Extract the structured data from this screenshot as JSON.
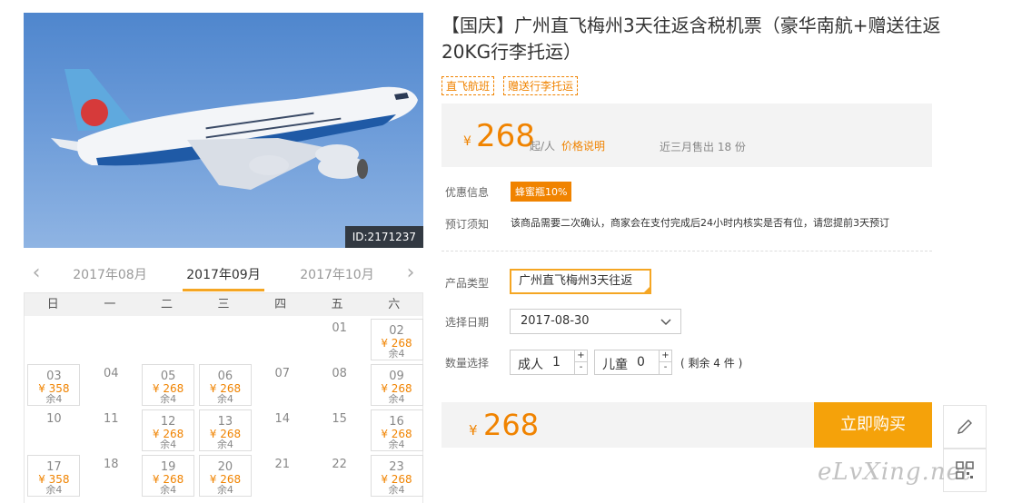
{
  "image": {
    "id_label": "ID:2171237"
  },
  "calendar": {
    "prev_icon": "chevron-left-icon",
    "next_icon": "chevron-right-icon",
    "months": [
      "2017年08月",
      "2017年09月",
      "2017年10月"
    ],
    "active_month_index": 1,
    "weekdays": [
      "日",
      "一",
      "二",
      "三",
      "四",
      "五",
      "六"
    ],
    "cells": [
      {
        "day": "01"
      },
      {
        "day": "02",
        "price": "¥ 268",
        "remain": "余4"
      },
      {
        "day": "03",
        "price": "¥ 358",
        "remain": "余4"
      },
      {
        "day": "04"
      },
      {
        "day": "05",
        "price": "¥ 268",
        "remain": "余4"
      },
      {
        "day": "06",
        "price": "¥ 268",
        "remain": "余4"
      },
      {
        "day": "07"
      },
      {
        "day": "08"
      },
      {
        "day": "09",
        "price": "¥ 268",
        "remain": "余4"
      },
      {
        "day": "10"
      },
      {
        "day": "11"
      },
      {
        "day": "12",
        "price": "¥ 268",
        "remain": "余4"
      },
      {
        "day": "13",
        "price": "¥ 268",
        "remain": "余4"
      },
      {
        "day": "14"
      },
      {
        "day": "15"
      },
      {
        "day": "16",
        "price": "¥ 268",
        "remain": "余4"
      },
      {
        "day": "17",
        "price": "¥ 358",
        "remain": "余4"
      },
      {
        "day": "18"
      },
      {
        "day": "19",
        "price": "¥ 268",
        "remain": "余4"
      },
      {
        "day": "20",
        "price": "¥ 268",
        "remain": "余4"
      },
      {
        "day": "21"
      },
      {
        "day": "22"
      },
      {
        "day": "23",
        "price": "¥ 268",
        "remain": "余4"
      }
    ]
  },
  "product": {
    "title": "【国庆】广州直飞梅州3天往返含税机票（豪华南航+赠送往返20KG行李托运）",
    "tags": [
      "直飞航班",
      "赠送行李托运"
    ],
    "price": {
      "currency": "¥",
      "amount": "268",
      "unit": "起/人",
      "explain_link": "价格说明",
      "sold": "近三月售出 18 份"
    },
    "promo": {
      "label": "优惠信息",
      "badge": "蜂蜜瓶10%"
    },
    "notice": {
      "label": "预订须知",
      "text": "该商品需要二次确认，商家会在支付完成后24小时内核实是否有位，请您提前3天预订"
    },
    "type": {
      "label": "产品类型",
      "value": "广州直飞梅州3天往返"
    },
    "date": {
      "label": "选择日期",
      "value": "2017-08-30",
      "chevron_icon": "chevron-down-icon"
    },
    "qty": {
      "label": "数量选择",
      "adult_label": "成人",
      "adult_value": "1",
      "child_label": "儿童",
      "child_value": "0",
      "up": "+",
      "down": "-",
      "remain": "( 剩余 4 件 )"
    }
  },
  "buy": {
    "currency": "¥",
    "total": "268",
    "button": "立即购买"
  },
  "side": {
    "edit_icon": "pencil-icon",
    "qr_icon": "qr-code-icon"
  },
  "watermark": "eLvXing.net",
  "colors": {
    "accent": "#f08300",
    "button": "#f5a20a",
    "active_border": "#f5a623"
  }
}
